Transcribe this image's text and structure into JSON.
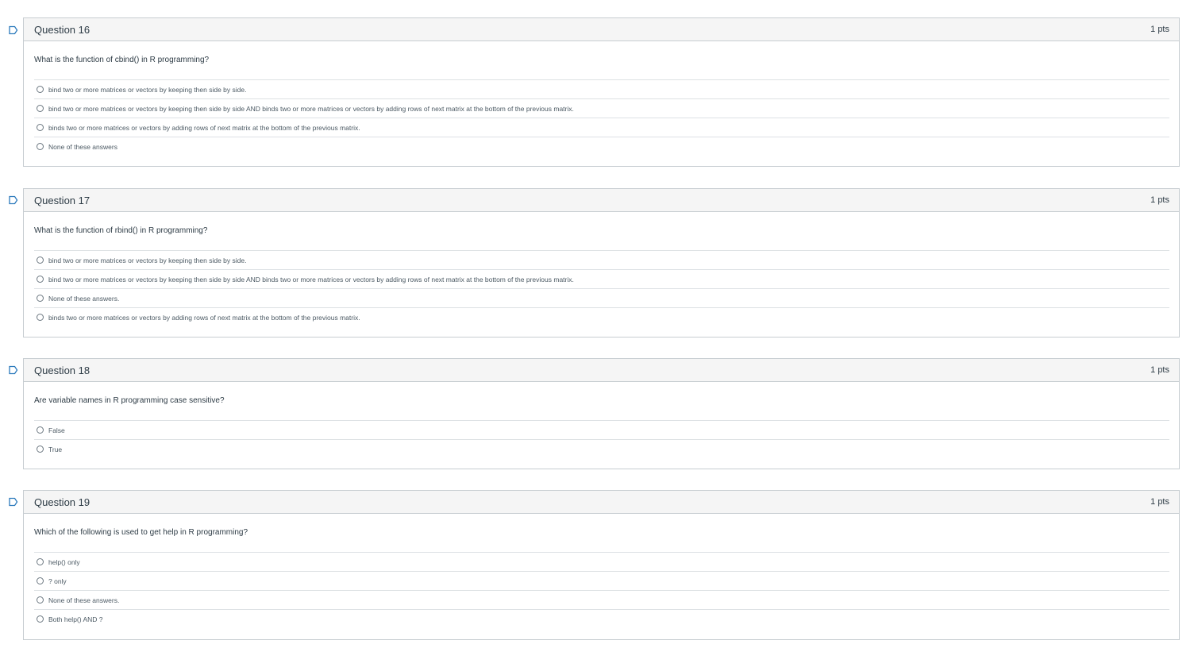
{
  "questions": [
    {
      "title": "Question 16",
      "points": "1 pts",
      "prompt": "What is the function of cbind() in R programming?",
      "answers": [
        "bind two or more matrices or vectors by keeping then side by side.",
        "bind two or more matrices or vectors by keeping then side by side AND binds two or more matrices or vectors by adding rows of next matrix at the bottom of the previous matrix.",
        "binds two or more matrices or vectors by adding rows of next matrix at the bottom of the previous matrix.",
        "None of these answers"
      ]
    },
    {
      "title": "Question 17",
      "points": "1 pts",
      "prompt": "What is the function of rbind() in R programming?",
      "answers": [
        "bind two or more matrices or vectors by keeping then side by side.",
        "bind two or more matrices or vectors by keeping then side by side AND binds two or more matrices or vectors by adding rows of next matrix at the bottom of the previous matrix.",
        "None of these answers.",
        "binds two or more matrices or vectors by adding rows of next matrix at the bottom of the previous matrix."
      ]
    },
    {
      "title": "Question 18",
      "points": "1 pts",
      "prompt": "Are variable names in R programming case sensitive?",
      "answers": [
        "False",
        "True"
      ]
    },
    {
      "title": "Question 19",
      "points": "1 pts",
      "prompt": "Which of the following is used to get help in R programming?",
      "answers": [
        "help() only",
        "? only",
        "None of these answers.",
        "Both help() AND ?"
      ]
    }
  ],
  "icons": {
    "flag": "bookmark-flag-icon",
    "radio": "radio-circle-icon"
  },
  "colors": {
    "header_bg": "#f5f5f5",
    "border": "#c7cdd1",
    "flag": "#2b7abc",
    "text": "#2d3b45"
  }
}
